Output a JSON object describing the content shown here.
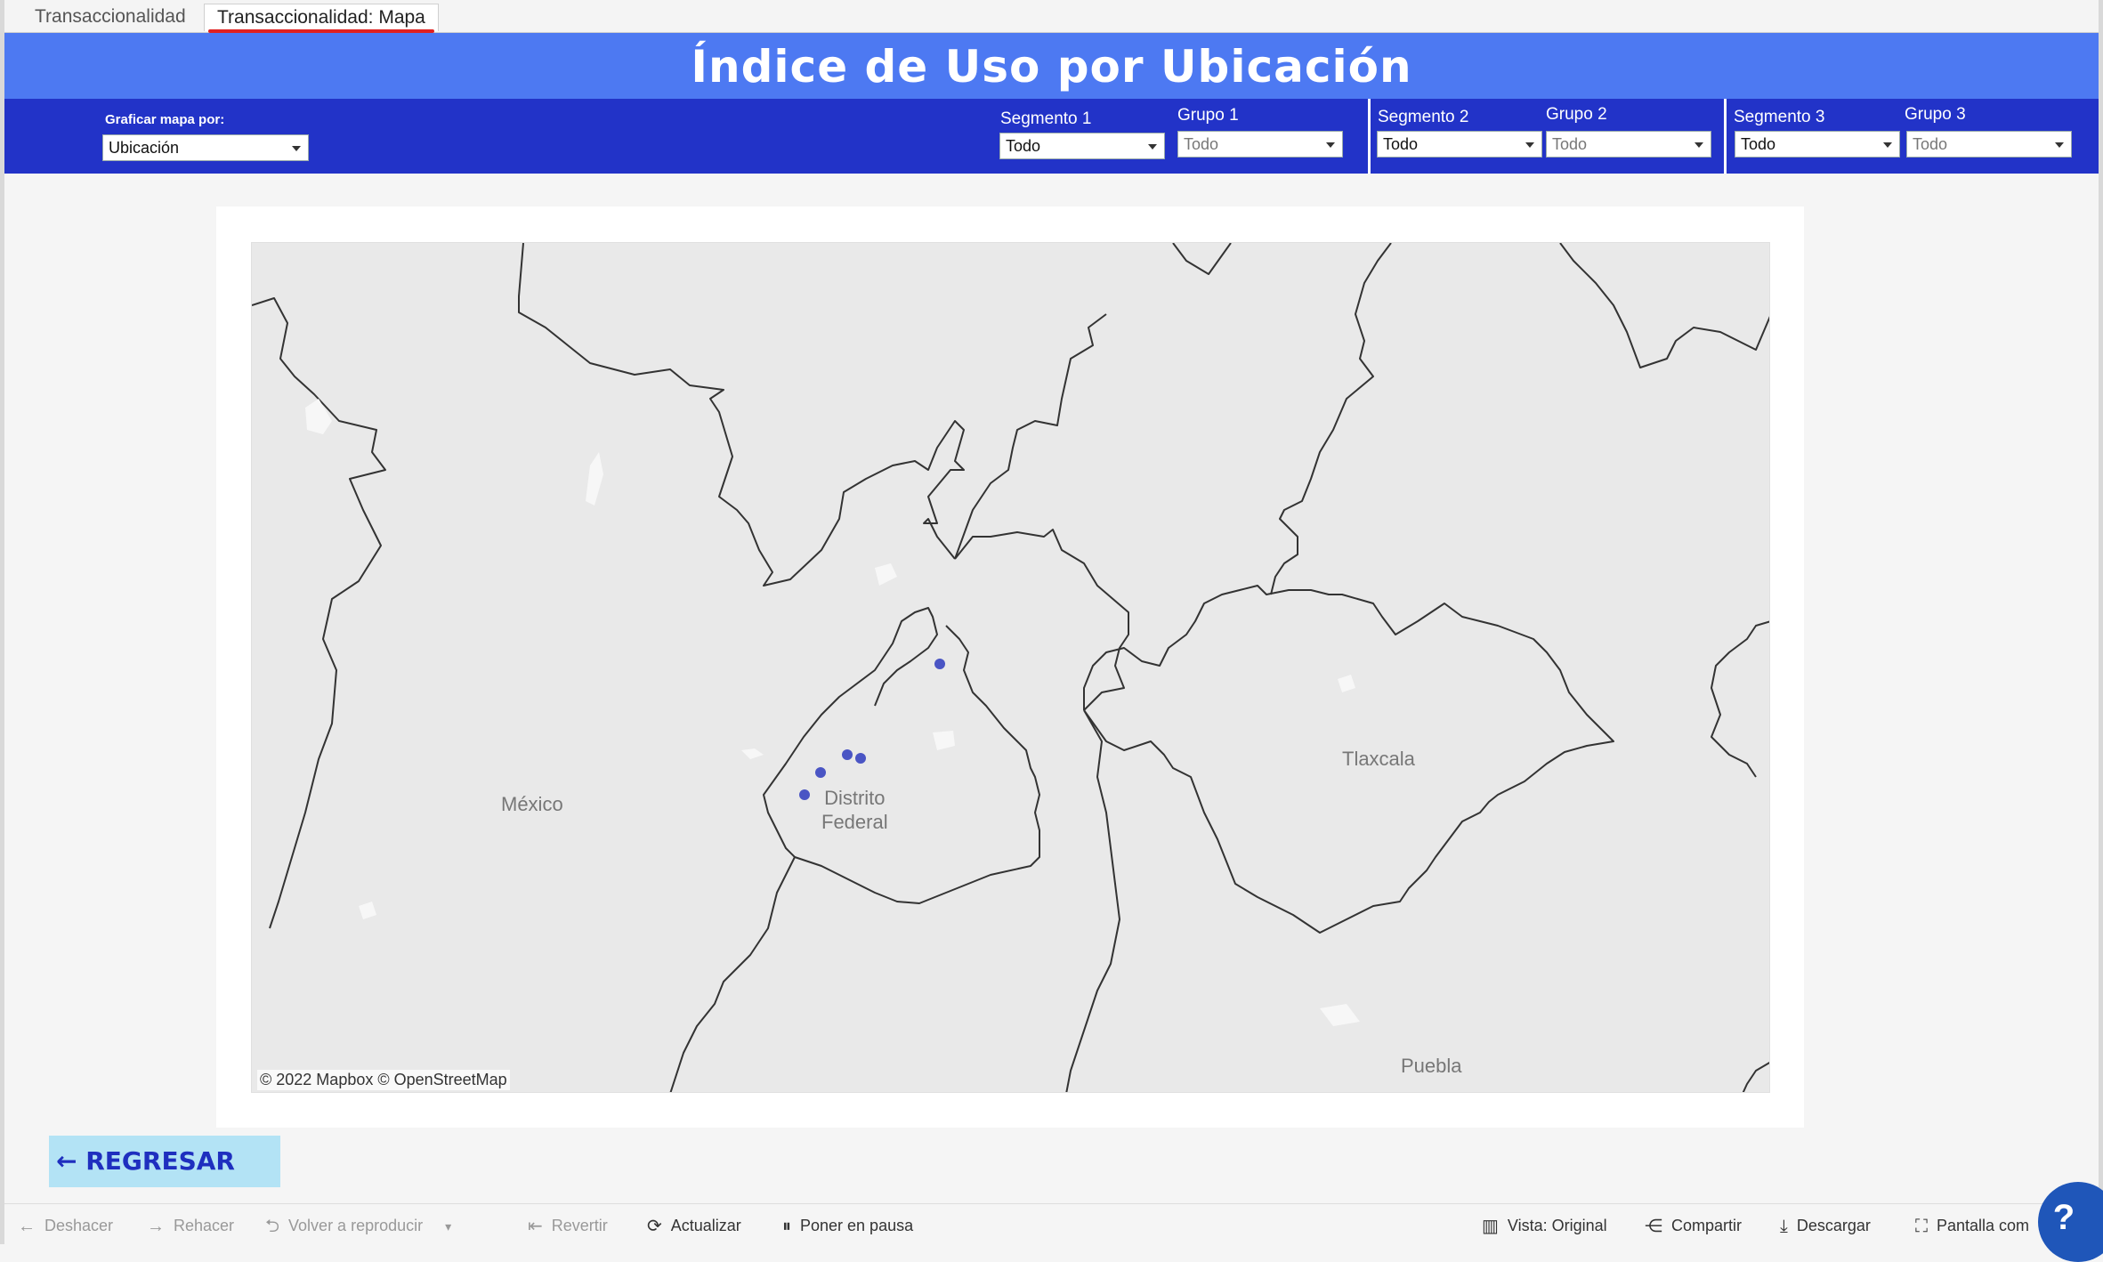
{
  "tabs": [
    {
      "label": "Transaccionalidad"
    },
    {
      "label": "Transaccionalidad: Mapa"
    }
  ],
  "title": "Índice de Uso por Ubicación",
  "filters": {
    "map_by": {
      "label": "Graficar mapa por:",
      "value": "Ubicación"
    },
    "segment1": {
      "label": "Segmento 1",
      "value": "Todo"
    },
    "group1": {
      "label": "Grupo 1",
      "value": "Todo"
    },
    "segment2": {
      "label": "Segmento 2",
      "value": "Todo"
    },
    "group2": {
      "label": "Grupo 2",
      "value": "Todo"
    },
    "segment3": {
      "label": "Segmento 3",
      "value": "Todo"
    },
    "group3": {
      "label": "Grupo 3",
      "value": "Todo"
    }
  },
  "map": {
    "labels": {
      "mexico": "México",
      "df_line1": "Distrito",
      "df_line2": "Federal",
      "tlaxcala": "Tlaxcala",
      "puebla": "Puebla"
    },
    "attribution": "© 2022 Mapbox  © OpenStreetMap",
    "marker_color": "#4a55c4",
    "land_color": "#e9e9e9",
    "boundary_color": "#333333"
  },
  "back_button": {
    "label": "← REGRESAR"
  },
  "toolbar": {
    "undo": "Deshacer",
    "redo": "Rehacer",
    "replay": "Volver a reproducir",
    "revert": "Revertir",
    "refresh": "Actualizar",
    "pause": "Poner en pausa",
    "view": "Vista: Original",
    "share": "Compartir",
    "download": "Descargar",
    "fullscreen": "Pantalla com"
  },
  "help": {
    "label": "?"
  }
}
